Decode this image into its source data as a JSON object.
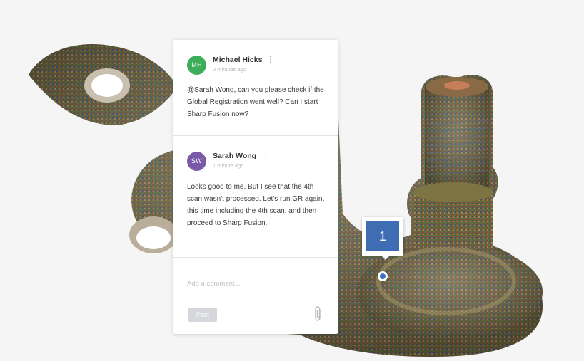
{
  "comments": [
    {
      "initials": "MH",
      "author": "Michael Hicks",
      "time": "2 minutes ago",
      "avatar_color": "#3cae5a",
      "text": "@Sarah Wong, can you please check if the Global Registration went well? Can I start Sharp Fusion now?"
    },
    {
      "initials": "SW",
      "author": "Sarah Wong",
      "time": "1 minute ago",
      "avatar_color": "#7a5aa8",
      "text": "Looks good to me. But I see that the 4th scan wasn't processed. Let's run GR again, this time including the 4th scan, and then proceed to Sharp Fusion."
    }
  ],
  "more_icon": "more-vertical-icon",
  "comment_input": {
    "placeholder": "Add a comment..."
  },
  "post_label": "Post",
  "attach_icon": "paperclip-icon",
  "marker": {
    "number": "1",
    "color": "#3f6db4"
  },
  "model": {
    "description_icon": "3d-scan-mesh"
  }
}
